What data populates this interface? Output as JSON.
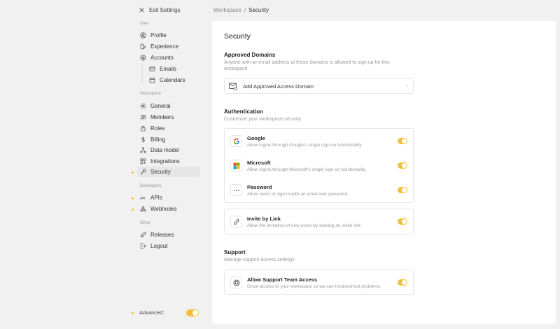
{
  "sidebar": {
    "exit_label": "Exit Settings",
    "sections": {
      "user": "User",
      "workspace": "Workspace",
      "developers": "Developers",
      "other": "Other"
    },
    "items": {
      "profile": "Profile",
      "experience": "Experience",
      "accounts": "Accounts",
      "emails": "Emails",
      "calendars": "Calendars",
      "general": "General",
      "members": "Members",
      "roles": "Roles",
      "billing": "Billing",
      "data_model": "Data model",
      "integrations": "Integrations",
      "security": "Security",
      "apis": "APIs",
      "webhooks": "Webhooks",
      "releases": "Releases",
      "logout": "Logout"
    },
    "advanced_label": "Advanced:",
    "advanced_on": true,
    "accent_color": "#f2c037"
  },
  "breadcrumb": {
    "parent": "Workspace",
    "separator": "/",
    "current": "Security"
  },
  "main": {
    "title": "Security",
    "approved_domains": {
      "heading": "Approved Domains",
      "description": "Anyone with an email address at these domains is allowed to sign up for this workspace.",
      "add_label": "Add Approved Access Domain"
    },
    "authentication": {
      "heading": "Authentication",
      "description": "Customize your workspace security",
      "providers": [
        {
          "title": "Google",
          "subtitle": "Allow logins through Google's single sign-on functionality.",
          "enabled": true,
          "icon": "google-icon"
        },
        {
          "title": "Microsoft",
          "subtitle": "Allow logins through Microsoft's single sign-on functionality.",
          "enabled": true,
          "icon": "microsoft-icon"
        },
        {
          "title": "Password",
          "subtitle": "Allow users to sign in with an email and password.",
          "enabled": true,
          "icon": "password-icon"
        }
      ],
      "invite": {
        "title": "Invite by Link",
        "subtitle": "Allow the invitation of new users by sharing an invite link.",
        "enabled": true,
        "icon": "link-icon"
      }
    },
    "support": {
      "heading": "Support",
      "description": "Manage support access settings",
      "access": {
        "title": "Allow Support Team Access",
        "subtitle": "Grant access to your workspace so we can troubleshoot problems.",
        "enabled": true,
        "icon": "support-icon"
      }
    }
  }
}
